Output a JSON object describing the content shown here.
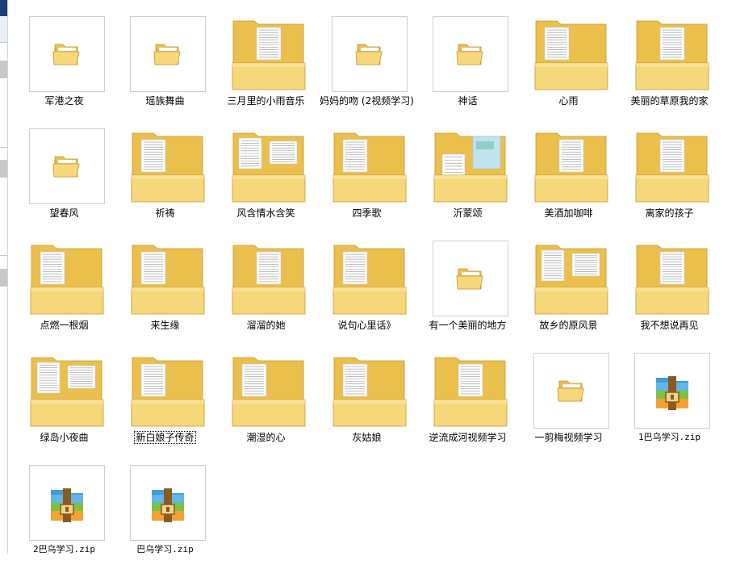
{
  "window": {
    "title": ""
  },
  "colors": {
    "folder_front": "#f6d77a",
    "folder_back": "#eabf4c",
    "folder_edge": "#c9962b",
    "zip_blue": "#3c9fd9",
    "zip_green": "#7cc243",
    "zip_orange": "#f3a233",
    "zip_belt": "#8a5a22"
  },
  "items": [
    {
      "label": "军港之夜",
      "kind": "small-folder"
    },
    {
      "label": "瑶族舞曲",
      "kind": "small-folder"
    },
    {
      "label": "三月里的小雨音乐",
      "kind": "big-folder",
      "preview": "single-center"
    },
    {
      "label": "妈妈的吻 (2视频学习)",
      "kind": "small-folder"
    },
    {
      "label": "神话",
      "kind": "small-folder"
    },
    {
      "label": "心雨",
      "kind": "big-folder",
      "preview": "single-left"
    },
    {
      "label": "美丽的草原我的家",
      "kind": "big-folder",
      "preview": "single-center"
    },
    {
      "label": "望春风",
      "kind": "small-folder"
    },
    {
      "label": "祈祷",
      "kind": "big-folder",
      "preview": "single-left"
    },
    {
      "label": "风含情水含笑",
      "kind": "big-folder",
      "preview": "double"
    },
    {
      "label": "四季歌",
      "kind": "big-folder",
      "preview": "single-left"
    },
    {
      "label": "沂蒙颂",
      "kind": "big-folder",
      "preview": "double-color"
    },
    {
      "label": "美酒加咖啡",
      "kind": "big-folder",
      "preview": "single-center"
    },
    {
      "label": "离家的孩子",
      "kind": "big-folder",
      "preview": "single-center"
    },
    {
      "label": "点燃一根烟",
      "kind": "big-folder",
      "preview": "single-left"
    },
    {
      "label": "来生缘",
      "kind": "big-folder",
      "preview": "single-left"
    },
    {
      "label": "溜溜的她",
      "kind": "big-folder",
      "preview": "single-center"
    },
    {
      "label": "说句心里话》",
      "kind": "big-folder",
      "preview": "single-left"
    },
    {
      "label": "有一个美丽的地方",
      "kind": "small-folder"
    },
    {
      "label": "故乡的原风景",
      "kind": "big-folder",
      "preview": "double"
    },
    {
      "label": "我不想说再见",
      "kind": "big-folder",
      "preview": "single-center"
    },
    {
      "label": "绿岛小夜曲",
      "kind": "big-folder",
      "preview": "double"
    },
    {
      "label": "新白娘子传奇",
      "kind": "big-folder",
      "preview": "single-left",
      "focused": true
    },
    {
      "label": "潮湿的心",
      "kind": "big-folder",
      "preview": "single-left"
    },
    {
      "label": "灰姑娘",
      "kind": "big-folder",
      "preview": "single-left"
    },
    {
      "label": "逆流成河视频学习",
      "kind": "big-folder",
      "preview": "single-center"
    },
    {
      "label": "一剪梅视频学习",
      "kind": "small-folder"
    },
    {
      "label": "1巴乌学习.zip",
      "kind": "zip"
    },
    {
      "label": "2巴乌学习.zip",
      "kind": "zip"
    },
    {
      "label": "巴乌学习.zip",
      "kind": "zip"
    }
  ]
}
